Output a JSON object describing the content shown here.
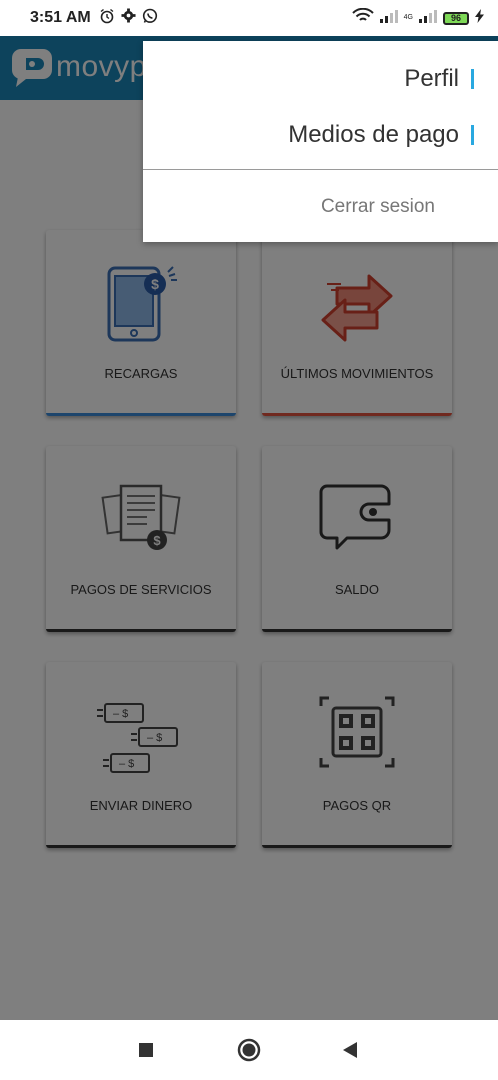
{
  "status_bar": {
    "time": "3:51 AM",
    "network_label": "4G",
    "battery": "96",
    "icons": [
      "alarm-icon",
      "gear-icon",
      "whatsapp-icon",
      "wifi-icon",
      "signal-icon",
      "signal-icon",
      "battery-icon",
      "charging-icon"
    ]
  },
  "app_bar": {
    "logo_text": "movyp"
  },
  "tiles": [
    {
      "label": "RECARGAS",
      "icon": "phone-recharge-icon",
      "accent": "#3b8ad8"
    },
    {
      "label": "ÚLTIMOS MOVIMIENTOS",
      "icon": "transfer-arrows-icon",
      "accent": "#e0533f"
    },
    {
      "label": "PAGOS DE SERVICIOS",
      "icon": "bills-icon",
      "accent": "#333333"
    },
    {
      "label": "SALDO",
      "icon": "wallet-icon",
      "accent": "#333333"
    },
    {
      "label": "ENVIAR DINERO",
      "icon": "send-money-icon",
      "accent": "#333333"
    },
    {
      "label": "PAGOS QR",
      "icon": "qr-icon",
      "accent": "#333333"
    }
  ],
  "menu": {
    "items": [
      {
        "label": "Perfil"
      },
      {
        "label": "Medios de pago"
      }
    ],
    "logout": "Cerrar sesion",
    "marker_color": "#29a8e0"
  },
  "nav": {
    "buttons": [
      "recents-icon",
      "home-icon",
      "back-icon"
    ]
  },
  "colors": {
    "brand": "#1b86b8",
    "overlay": "rgba(0,0,0,0.5)"
  }
}
